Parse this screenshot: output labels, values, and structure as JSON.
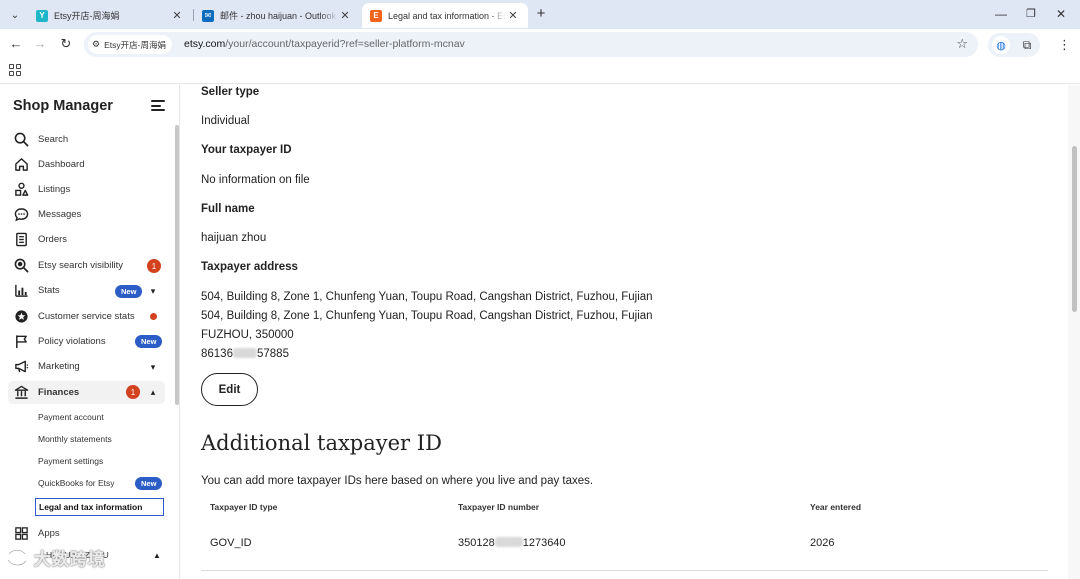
{
  "browser": {
    "tabs": [
      {
        "title": "Etsy开店-周海娟",
        "favicon_color": "#1fb6c9",
        "favicon_glyph": "Y"
      },
      {
        "title": "邮件 - zhou haijuan - Outlook",
        "favicon_color": "#0f6cbd",
        "favicon_glyph": "✉"
      },
      {
        "title": "Legal and tax information - Etsy",
        "favicon_color": "#f1641e",
        "favicon_glyph": "E"
      }
    ],
    "site_chip": "Etsy开店-周海娟",
    "url_host": "etsy.com",
    "url_path": "/your/account/taxpayerid?ref=seller-platform-mcnav"
  },
  "sidebar": {
    "title": "Shop Manager",
    "items": [
      {
        "label": "Search",
        "icon": "search-icon"
      },
      {
        "label": "Dashboard",
        "icon": "home-icon"
      },
      {
        "label": "Listings",
        "icon": "listings-icon"
      },
      {
        "label": "Messages",
        "icon": "messages-icon"
      },
      {
        "label": "Orders",
        "icon": "orders-icon"
      },
      {
        "label": "Etsy search visibility",
        "icon": "search-visibility-icon",
        "badge": "1"
      },
      {
        "label": "Stats",
        "icon": "stats-icon",
        "badge_new": "New"
      },
      {
        "label": "Customer service stats",
        "icon": "customer-service-icon"
      },
      {
        "label": "Policy violations",
        "icon": "flag-icon",
        "badge_new": "New"
      },
      {
        "label": "Marketing",
        "icon": "megaphone-icon"
      },
      {
        "label": "Finances",
        "icon": "bank-icon",
        "badge": "1"
      }
    ],
    "finances_sub": [
      {
        "label": "Payment account"
      },
      {
        "label": "Monthly statements"
      },
      {
        "label": "Payment settings"
      },
      {
        "label": "QuickBooks for Etsy",
        "badge_new": "New"
      },
      {
        "label": "Legal and tax information"
      }
    ],
    "apps_label": "Apps",
    "account_label": "HAIJUAN ZHOU",
    "watermark": "大数跨境"
  },
  "main": {
    "seller_type_label": "Seller type",
    "seller_type_value": "Individual",
    "taxpayer_id_label": "Your taxpayer ID",
    "taxpayer_id_value": "No information on file",
    "full_name_label": "Full name",
    "full_name_value": "haijuan zhou",
    "address_label": "Taxpayer address",
    "address_line1": "504, Building 8, Zone 1, Chunfeng Yuan, Toupu Road, Cangshan District, Fuzhou, Fujian",
    "address_line2": "504, Building 8, Zone 1, Chunfeng Yuan, Toupu Road, Cangshan District, Fuzhou, Fujian",
    "address_line3": "FUZHOU, 350000",
    "phone_prefix": "86136",
    "phone_suffix": "57885",
    "edit_label": "Edit",
    "additional_title": "Additional taxpayer ID",
    "additional_desc": "You can add more taxpayer IDs here based on where you live and pay taxes.",
    "table": {
      "headers": [
        "Taxpayer ID type",
        "Taxpayer ID number",
        "Year entered"
      ],
      "rows": [
        {
          "type": "GOV_ID",
          "number_prefix": "350128",
          "number_suffix": "1273640",
          "year": "2026"
        }
      ]
    }
  }
}
